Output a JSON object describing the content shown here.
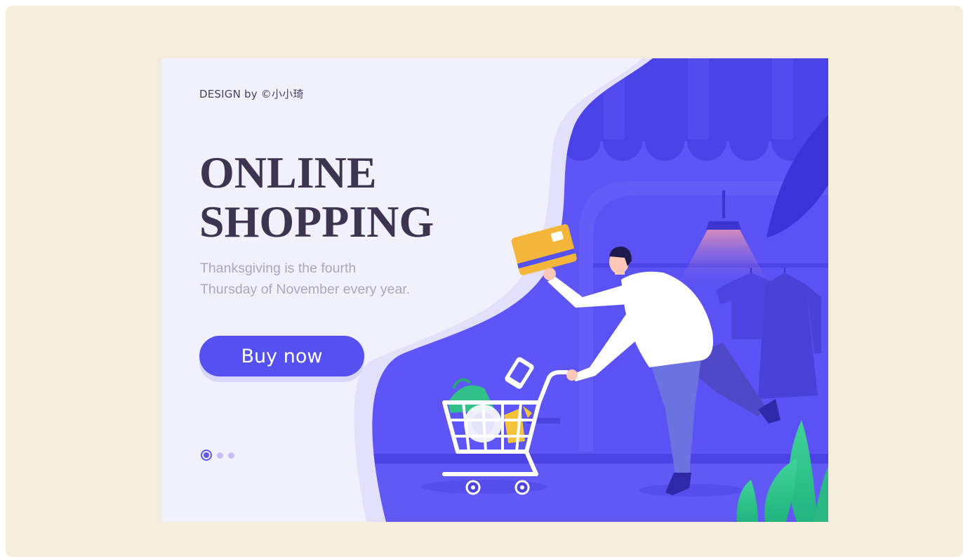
{
  "banner": {
    "credit": "DESIGN by ©小小琦",
    "title_line1": "ONLINE",
    "title_line2": "SHOPPING",
    "subtitle_line1": "Thanksgiving is the fourth",
    "subtitle_line2": "Thursday of November every year.",
    "cta_label": "Buy now"
  },
  "carousel": {
    "slide_count": 3,
    "active_index": 0
  },
  "colors": {
    "page_background": "#f5eddb",
    "banner_background": "#f1f0fd",
    "accent_purple": "#5550f0",
    "title_text": "#3d3450",
    "subtitle_text": "#a9a8bd",
    "card_yellow": "#f3b63a",
    "plant_green": "#34c98e"
  },
  "illustration": {
    "icons": [
      "shopping-cart-icon",
      "credit-card-icon",
      "phone-icon",
      "ceiling-lamp-icon",
      "clothes-hanger-icon",
      "shopping-bag-icon",
      "plant-icon",
      "store-awning-icon"
    ]
  }
}
